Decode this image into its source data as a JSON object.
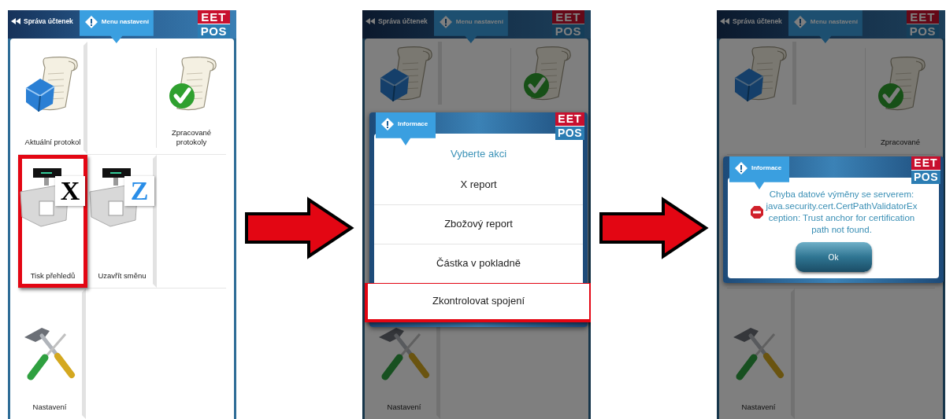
{
  "screens": [
    {
      "dimmed": false,
      "header": {
        "back": "Správa účtenek",
        "tab": "Menu nastavení",
        "logo_top": "EET",
        "logo_bottom": "POS"
      },
      "tiles": [
        {
          "kind": "current-protocol",
          "label": "Aktuální protokol",
          "highlighted": false
        },
        {
          "kind": "empty"
        },
        {
          "kind": "processed-protocols",
          "label": "Zpracované protokoly",
          "highlighted": false
        },
        {
          "kind": "register",
          "badge": "X",
          "color": "#000000",
          "label": "Tisk přehledů",
          "highlighted": true
        },
        {
          "kind": "register",
          "badge": "Z",
          "color": "#2a8ee8",
          "label": "Uzavřít směnu",
          "highlighted": false
        },
        {
          "kind": "empty"
        },
        {
          "kind": "tools",
          "label": "Nastavení",
          "highlighted": false
        }
      ]
    },
    {
      "dimmed": true,
      "header": {
        "back": "Správa účtenek",
        "tab": "Menu nastavení",
        "logo_top": "EET",
        "logo_bottom": "POS"
      },
      "tiles": [
        {
          "kind": "current-protocol",
          "highlighted": false
        },
        {
          "kind": "empty"
        },
        {
          "kind": "processed-protocols",
          "highlighted": false
        },
        {
          "kind": "empty"
        },
        {
          "kind": "empty"
        },
        {
          "kind": "empty"
        },
        {
          "kind": "tools",
          "label": "Nastavení",
          "highlighted": false
        }
      ],
      "dialog": {
        "kind": "menu",
        "title": "Informace",
        "logo_top": "EET",
        "logo_bottom": "POS",
        "heading": "Vyberte akci",
        "items": [
          {
            "label": "X report",
            "highlighted": false
          },
          {
            "label": "Zbožový report",
            "highlighted": false
          },
          {
            "label": "Částka v pokladně",
            "highlighted": false
          },
          {
            "label": "Zkontrolovat spojení",
            "highlighted": true
          }
        ]
      }
    },
    {
      "dimmed": true,
      "header": {
        "back": "Správa účtenek",
        "tab": "Menu nastavení",
        "logo_top": "EET",
        "logo_bottom": "POS"
      },
      "tiles": [
        {
          "kind": "current-protocol",
          "highlighted": false
        },
        {
          "kind": "empty"
        },
        {
          "kind": "processed-protocols",
          "label": "Zpracované",
          "highlighted": false
        },
        {
          "kind": "empty"
        },
        {
          "kind": "empty"
        },
        {
          "kind": "empty"
        },
        {
          "kind": "tools",
          "label": "Nastavení",
          "highlighted": false
        }
      ],
      "dialog": {
        "kind": "error",
        "title": "Informace",
        "logo_top": "EET",
        "logo_bottom": "POS",
        "message_lines": [
          "Chyba datové výměny se serverem:",
          "java.security.cert.CertPathValidatorEx",
          "ception: Trust anchor for certification",
          "path not found."
        ],
        "button": "Ok"
      }
    }
  ]
}
